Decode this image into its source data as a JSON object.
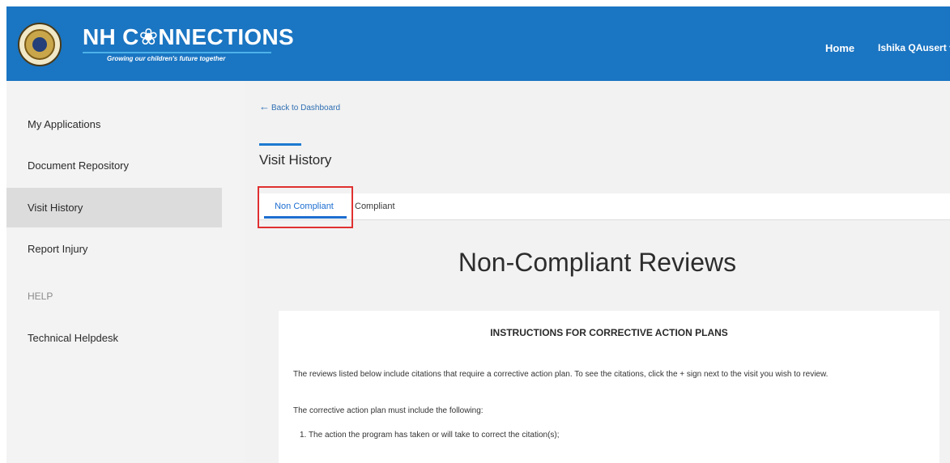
{
  "header": {
    "brand_title": "NH C❀NNECTIONS",
    "tagline": "Growing our children's future together",
    "nav": {
      "home": "Home",
      "user": "Ishika QAusert ▾"
    },
    "colors": {
      "bar": "#1a75c2",
      "rule": "#4db2e8"
    }
  },
  "sidebar": {
    "items": [
      {
        "label": "My Applications"
      },
      {
        "label": "Document Repository"
      },
      {
        "label": "Visit History",
        "active": true
      },
      {
        "label": "Report Injury"
      },
      {
        "label": "HELP",
        "heading": true
      },
      {
        "label": "Technical Helpdesk"
      }
    ]
  },
  "main": {
    "back_link": "Back to Dashboard",
    "page_title": "Visit History",
    "tabs": [
      {
        "label": "Non Compliant",
        "selected": true
      },
      {
        "label": "Compliant"
      }
    ],
    "heading": "Non-Compliant Reviews",
    "instructions": {
      "title": "INSTRUCTIONS FOR CORRECTIVE ACTION PLANS",
      "paragraph1": "The reviews listed below include citations that require a corrective action plan. To see the citations, click the + sign next to the visit you wish to review.",
      "paragraph2": "The corrective action plan must include the following:",
      "list_item_1": "1. The action the program has taken or will take to correct the citation(s);"
    }
  },
  "accent_colors": {
    "active_tab": "#1d6ed0",
    "highlight_box": "#e03030"
  }
}
